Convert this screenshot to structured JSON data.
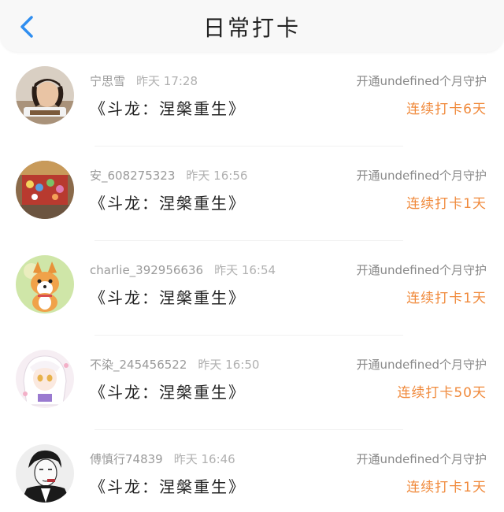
{
  "header": {
    "title": "日常打卡",
    "back_icon": "chevron-left-icon",
    "accent_color": "#2f8ef0"
  },
  "entries": [
    {
      "name": "宁思雪",
      "time": "昨天 17:28",
      "book": "《斗龙：涅槃重生》",
      "guard_text": "开通undefined个月守护",
      "streak": "连续打卡6天",
      "avatar": "avatar-girl-photo"
    },
    {
      "name": "安_608275323",
      "time": "昨天 16:56",
      "book": "《斗龙：涅槃重生》",
      "guard_text": "开通undefined个月守护",
      "streak": "连续打卡1天",
      "avatar": "avatar-room-photo"
    },
    {
      "name": "charlie_392956636",
      "time": "昨天 16:54",
      "book": "《斗龙：涅槃重生》",
      "guard_text": "开通undefined个月守护",
      "streak": "连续打卡1天",
      "avatar": "avatar-corgi"
    },
    {
      "name": "不染_245456522",
      "time": "昨天 16:50",
      "book": "《斗龙：涅槃重生》",
      "guard_text": "开通undefined个月守护",
      "streak": "连续打卡50天",
      "avatar": "avatar-anime-girl"
    },
    {
      "name": "傅慎行74839",
      "time": "昨天 16:46",
      "book": "《斗龙：涅槃重生》",
      "guard_text": "开通undefined个月守护",
      "streak": "连续打卡1天",
      "avatar": "avatar-manga-man"
    }
  ],
  "colors": {
    "streak": "#f08a3c",
    "meta": "#9a9a9a",
    "header_bg": "#f8f8f8"
  }
}
